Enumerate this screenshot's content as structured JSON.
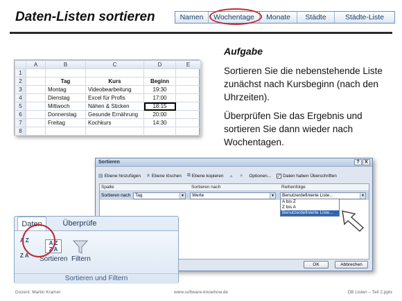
{
  "slide": {
    "title": "Daten-Listen sortieren"
  },
  "nav": {
    "tabs": [
      "Namen",
      "Wochentage",
      "Monate",
      "Städte",
      "Städte-Liste"
    ]
  },
  "sheet": {
    "columns": [
      "",
      "A",
      "B",
      "C",
      "D",
      "E"
    ],
    "rows": [
      {
        "n": "1",
        "tag": "",
        "kurs": "",
        "beginn": ""
      },
      {
        "n": "2",
        "tag": "Tag",
        "kurs": "Kurs",
        "beginn": "Beginn"
      },
      {
        "n": "3",
        "tag": "Montag",
        "kurs": "Videobearbeitung",
        "beginn": "19:30"
      },
      {
        "n": "4",
        "tag": "Dienstag",
        "kurs": "Excel für Profis",
        "beginn": "17:00"
      },
      {
        "n": "5",
        "tag": "Mittwoch",
        "kurs": "Nähen & Sticken",
        "beginn": "18:15"
      },
      {
        "n": "6",
        "tag": "Donnerstag",
        "kurs": "Gesunde Ernährung",
        "beginn": "20:00"
      },
      {
        "n": "7",
        "tag": "Freitag",
        "kurs": "Kochkurs",
        "beginn": "14:30"
      },
      {
        "n": "8",
        "tag": "",
        "kurs": "",
        "beginn": ""
      }
    ]
  },
  "task": {
    "heading": "Aufgabe",
    "p1": "Sortieren Sie die nebenstehende Liste zunächst nach Kursbeginn (nach den Uhrzeiten).",
    "p2": "Überprüfen Sie das Ergebnis und sortieren Sie dann wieder nach Wochentagen."
  },
  "dialog": {
    "title": "Sortieren",
    "help": "?",
    "close": "X",
    "toolbar": {
      "add": "Ebene hinzufügen",
      "delete": "Ebene löschen",
      "copy": "Ebene kopieren",
      "options": "Optionen...",
      "headers": "Daten haben Überschriften"
    },
    "headers": {
      "col": "Spalte",
      "sort_on": "Sortieren nach",
      "order": "Reihenfolge"
    },
    "row": {
      "label": "Sortieren nach",
      "column": "Tag",
      "sort_on": "Werte",
      "order": "Benutzerdefinierte Liste..."
    },
    "dropdown": [
      "A bis Z",
      "Z bis A",
      "Benutzerdefinierte Liste..."
    ],
    "ok": "OK",
    "cancel": "Abbrechen"
  },
  "ribbon": {
    "tab_active": "Daten",
    "tab_inactive": "Überprüfe",
    "sort_label": "Sortieren",
    "filter_label": "Filtern",
    "group_label": "Sortieren und Filtern",
    "az": "A Z",
    "za": "Z A"
  },
  "footer": {
    "left": "Dozent: Martin Kramer",
    "center": "www.software-knowhow.de",
    "right": "DB Listen – Teil 2.pptx"
  },
  "colors": {
    "highlight": "#c1272d",
    "nav_text": "#1d3b63"
  }
}
